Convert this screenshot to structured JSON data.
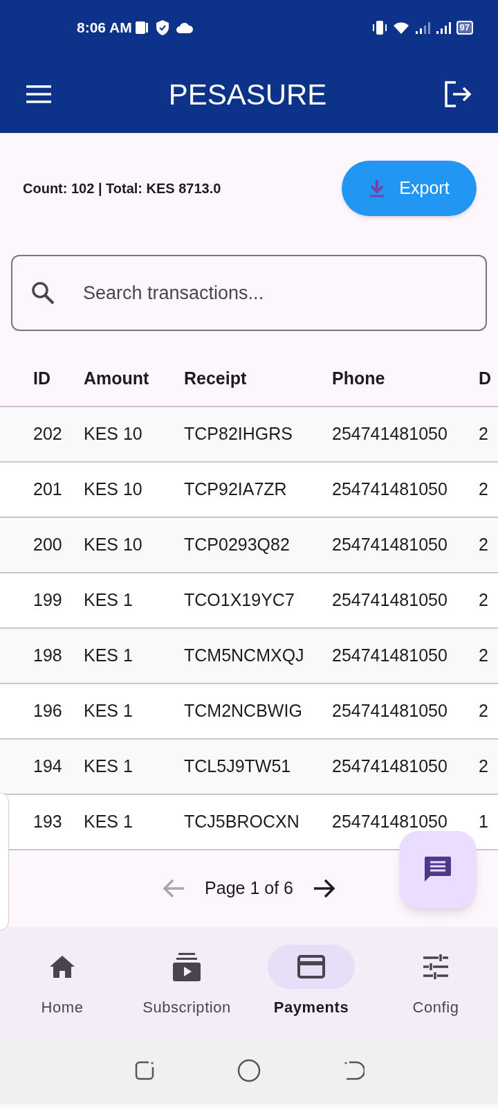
{
  "status_bar": {
    "time": "8:06 AM",
    "battery": "97"
  },
  "app_bar": {
    "title": "PESASURE"
  },
  "summary": {
    "text": "Count: 102 | Total: KES 8713.0",
    "export_label": "Export"
  },
  "search": {
    "placeholder": "Search transactions..."
  },
  "table": {
    "columns": [
      "ID",
      "Amount",
      "Receipt",
      "Phone",
      "D"
    ],
    "rows": [
      [
        "202",
        "KES 10",
        "TCP82IHGRS",
        "254741481050",
        "2"
      ],
      [
        "201",
        "KES 10",
        "TCP92IA7ZR",
        "254741481050",
        "2"
      ],
      [
        "200",
        "KES 10",
        "TCP0293Q82",
        "254741481050",
        "2"
      ],
      [
        "199",
        "KES 1",
        "TCO1X19YC7",
        "254741481050",
        "2"
      ],
      [
        "198",
        "KES 1",
        "TCM5NCMXQJ",
        "254741481050",
        "2"
      ],
      [
        "196",
        "KES 1",
        "TCM2NCBWIG",
        "254741481050",
        "2"
      ],
      [
        "194",
        "KES 1",
        "TCL5J9TW51",
        "254741481050",
        "2"
      ],
      [
        "193",
        "KES 1",
        "TCJ5BROCXN",
        "254741481050",
        "1"
      ]
    ]
  },
  "pagination": {
    "label": "Page 1 of 6",
    "previous_disabled": true,
    "next_disabled": false
  },
  "bottom_nav": [
    {
      "kind": "home",
      "label": "Home",
      "selected": false
    },
    {
      "kind": "subscription",
      "label": "Subscription",
      "selected": false
    },
    {
      "kind": "payments",
      "label": "Payments",
      "selected": true
    },
    {
      "kind": "config",
      "label": "Config",
      "selected": false
    }
  ]
}
